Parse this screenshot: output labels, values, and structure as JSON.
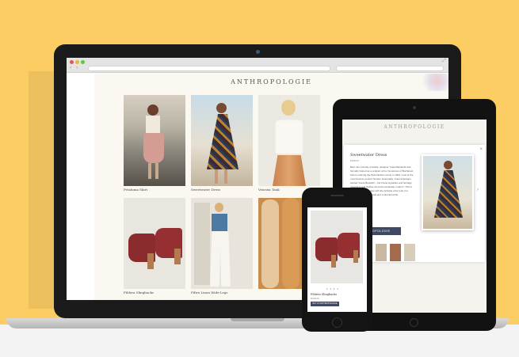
{
  "colors": {
    "background": "#fbcd63",
    "button": "#3f4964",
    "device": "#1b1b1b"
  },
  "brand": {
    "logo": "ANTHROPOLOGIE"
  },
  "laptop": {
    "products": [
      {
        "name": "Petaluma Skirt"
      },
      {
        "name": "Sweetwater Dress"
      },
      {
        "name": "Venezia Tank"
      },
      {
        "name": "Fildera Slingbacks"
      },
      {
        "name": "Filtre Linen Wide-Legs"
      }
    ]
  },
  "tablet": {
    "title": "Sweetwater Dress",
    "price": "$198.00",
    "description": "Born into a family of artists, designer Yoana Baraschi was formally trained as a sculptor at her hometown of Bucharest before entering the Paris fashion scene in 1994, most of the most famous couture houses. Eventually, Yoanna designs started Yoana Baraschi – her brand signature and heritage selections and clothes are both completely modern. This is a the embroidered lace with the intricate color look, her pairing embellished folds and a structured life.",
    "button": "ANTHROPOLOGIE",
    "close_icon": "close-icon"
  },
  "phone": {
    "title": "Fildera Slingbacks",
    "price": "$198.00",
    "dots": "• • • •",
    "button": "BUY AT ANTHROPOLOGIE"
  }
}
